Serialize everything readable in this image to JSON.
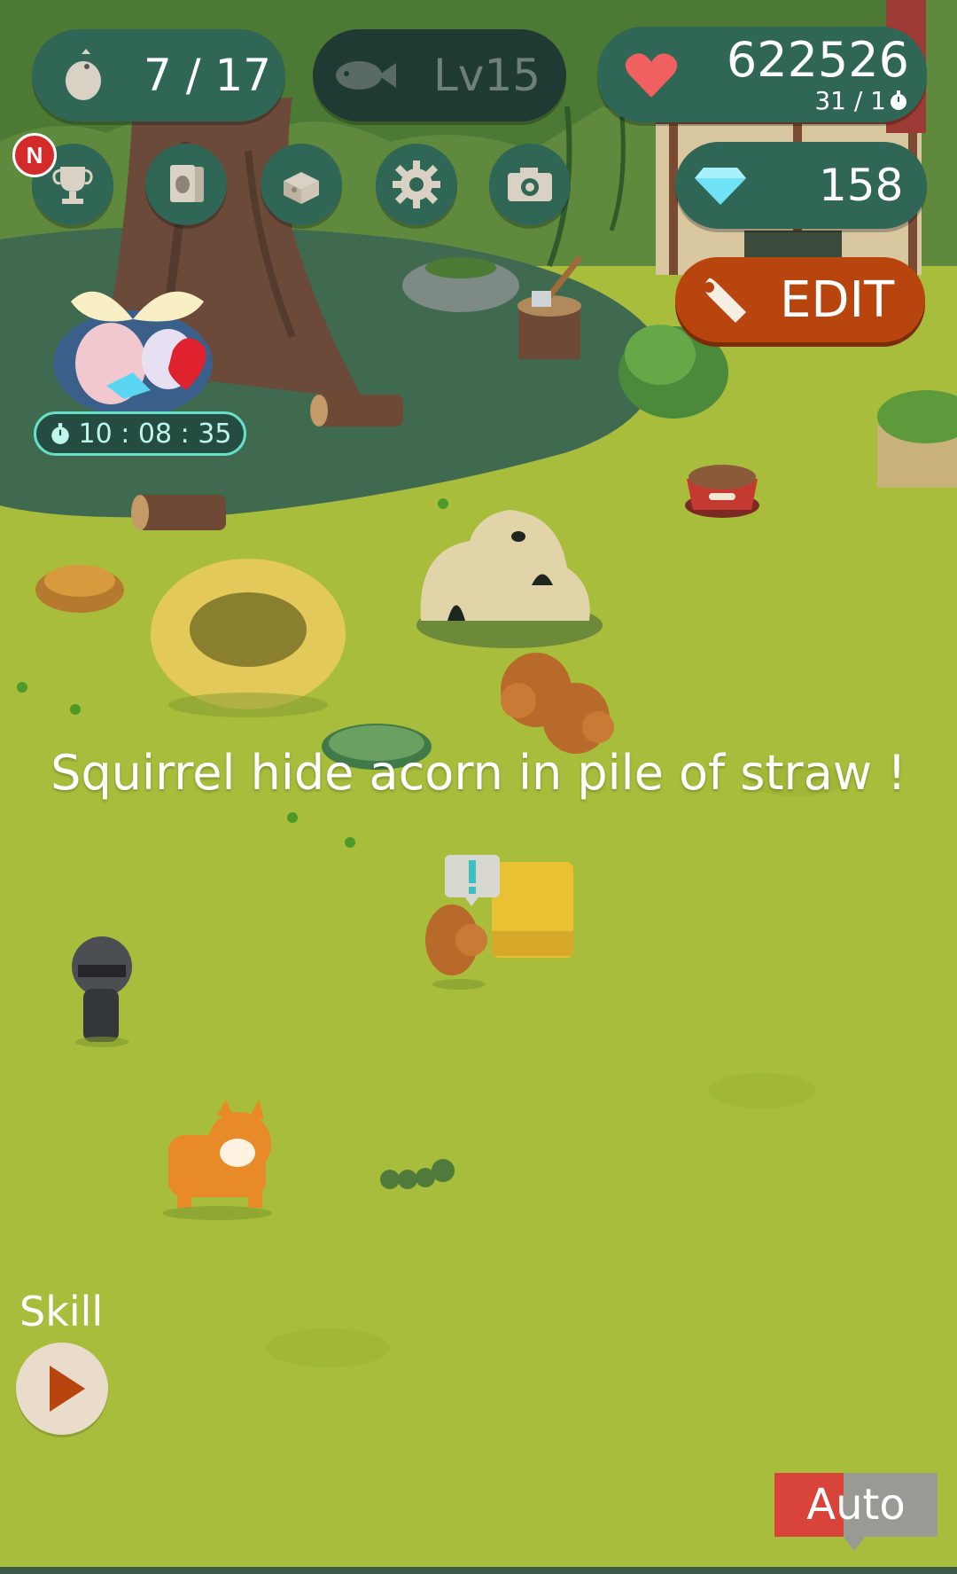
{
  "hud": {
    "animals_count": "7 / 17",
    "fish_level": "Lv15",
    "hearts_value": "622526",
    "hearts_sub": "31  /  1",
    "gems_value": "158",
    "new_badge": "N"
  },
  "toolbar": {
    "icons": [
      "trophy-icon",
      "cards-icon",
      "box-icon",
      "gear-icon",
      "camera-icon"
    ]
  },
  "edit_button": {
    "label": "EDIT"
  },
  "gift": {
    "timer": "10 : 08 : 35"
  },
  "message": {
    "text": "Squirrel hide acorn in pile of straw !"
  },
  "skill": {
    "label": "Skill"
  },
  "auto_button": {
    "label": "Auto"
  },
  "colors": {
    "grass": "#a8bd3c",
    "shade": "#4e7a52",
    "pill": "#2f6656",
    "edit": "#b8440e",
    "auto_red": "#d9443a",
    "auto_gray": "#9a9a94"
  }
}
